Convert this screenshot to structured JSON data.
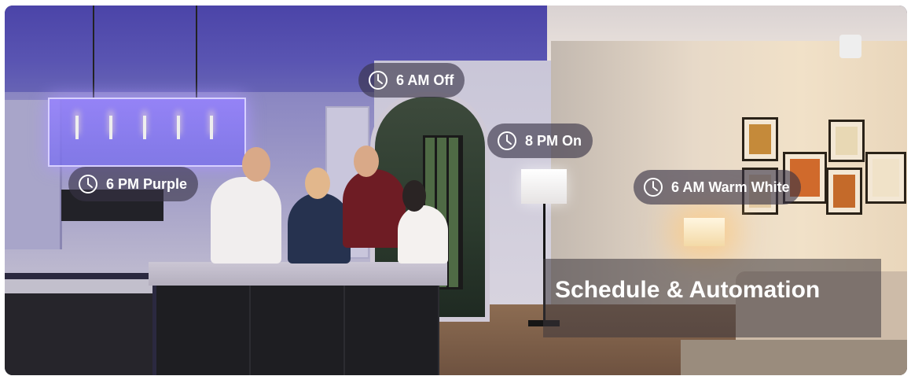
{
  "scene": {
    "description_icon": "clock-icon"
  },
  "schedule_pills": [
    {
      "label": "6 AM Off"
    },
    {
      "label": "8 PM On"
    },
    {
      "label": "6 PM Purple"
    },
    {
      "label": "6 AM Warm White"
    }
  ],
  "headline": "Schedule & Automation",
  "colors": {
    "pill_background": "#37324699",
    "text": "#ffffff",
    "purple_light": "#7c6cf0",
    "warm_light": "#f3d9a6"
  }
}
